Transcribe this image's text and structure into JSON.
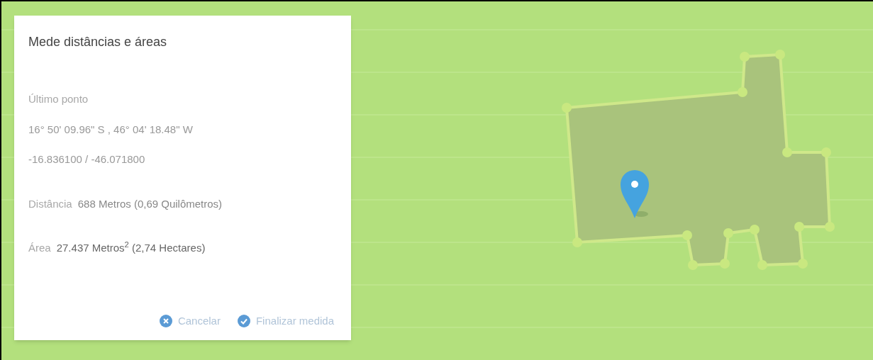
{
  "panel": {
    "title": "Mede distâncias e áreas",
    "last_point": {
      "label": "Último ponto",
      "dms": "16° 50' 09.96\" S , 46° 04' 18.48\" W",
      "decimal": "-16.836100 / -46.071800"
    },
    "distance": {
      "label": "Distância",
      "value": "688 Metros (0,69 Quilômetros)"
    },
    "area": {
      "label": "Área",
      "value": "27.437 Metros$^{2}$ (2,74 Hectares)"
    },
    "actions": [
      {
        "kind": "cancel",
        "label": "Cancelar"
      },
      {
        "kind": "finish",
        "label": "Finalizar medida"
      }
    ]
  }
}
